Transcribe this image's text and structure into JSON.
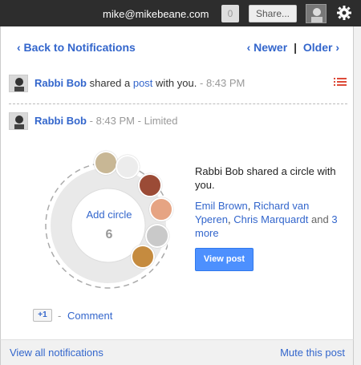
{
  "topbar": {
    "email": "mike@mikebeane.com",
    "notification_count": "0",
    "share_label": "Share...",
    "avatar_icon": "user-avatar",
    "settings_icon": "gear-icon"
  },
  "header": {
    "back_label": "‹ Back to Notifications",
    "newer_label": "‹ Newer",
    "separator": "|",
    "older_label": "Older ›"
  },
  "notification_summary": {
    "author": "Rabbi Bob",
    "action_prefix": "shared a",
    "post_link": "post",
    "action_suffix": "with you.",
    "separator": "-",
    "time": "8:43 PM",
    "menu_icon": "list-icon"
  },
  "post": {
    "author": "Rabbi Bob",
    "separator1": "-",
    "time": "8:43 PM",
    "separator2": "-",
    "visibility": "Limited",
    "circle_add_label": "Add circle",
    "circle_count": "6",
    "share_text": "Rabbi Bob shared a circle with you.",
    "people": [
      "Emil Brown",
      "Richard van Yperen",
      "Chris Marquardt"
    ],
    "and_text": "and",
    "more_link": "3 more",
    "view_post_label": "View post",
    "plusone_label": "+1",
    "comment_separator": "-",
    "comment_label": "Comment"
  },
  "footer": {
    "view_all_label": "View all notifications",
    "mute_label": "Mute this post"
  },
  "colors": {
    "link": "#3366cc",
    "topbar": "#2d2d2d",
    "button": "#4d90fe",
    "menu_icon": "#dd4b39"
  }
}
